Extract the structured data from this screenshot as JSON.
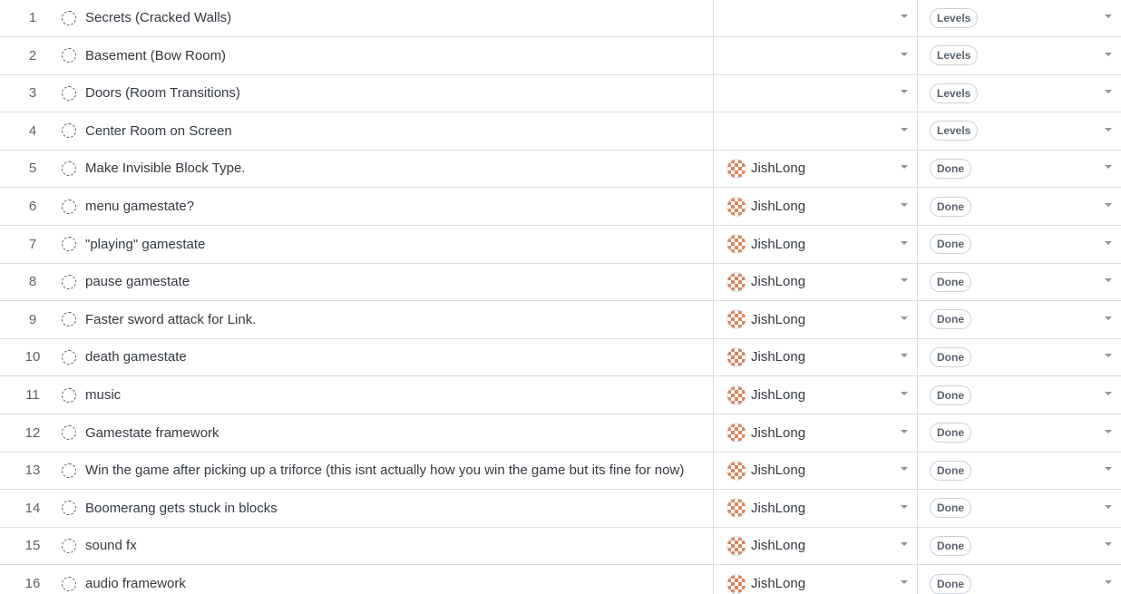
{
  "rows": [
    {
      "num": "1",
      "title": "Secrets (Cracked Walls)",
      "assignee": "",
      "status": "Levels"
    },
    {
      "num": "2",
      "title": "Basement (Bow Room)",
      "assignee": "",
      "status": "Levels"
    },
    {
      "num": "3",
      "title": "Doors (Room Transitions)",
      "assignee": "",
      "status": "Levels"
    },
    {
      "num": "4",
      "title": "Center Room on Screen",
      "assignee": "",
      "status": "Levels"
    },
    {
      "num": "5",
      "title": "Make Invisible Block Type.",
      "assignee": "JishLong",
      "status": "Done"
    },
    {
      "num": "6",
      "title": "menu gamestate?",
      "assignee": "JishLong",
      "status": "Done"
    },
    {
      "num": "7",
      "title": "\"playing\" gamestate",
      "assignee": "JishLong",
      "status": "Done"
    },
    {
      "num": "8",
      "title": "pause gamestate",
      "assignee": "JishLong",
      "status": "Done"
    },
    {
      "num": "9",
      "title": "Faster sword attack for Link.",
      "assignee": "JishLong",
      "status": "Done"
    },
    {
      "num": "10",
      "title": "death gamestate",
      "assignee": "JishLong",
      "status": "Done"
    },
    {
      "num": "11",
      "title": "music",
      "assignee": "JishLong",
      "status": "Done"
    },
    {
      "num": "12",
      "title": "Gamestate framework",
      "assignee": "JishLong",
      "status": "Done"
    },
    {
      "num": "13",
      "title": "Win the game after picking up a triforce (this isnt actually how you win the game but its fine for now)",
      "assignee": "JishLong",
      "status": "Done"
    },
    {
      "num": "14",
      "title": "Boomerang gets stuck in blocks",
      "assignee": "JishLong",
      "status": "Done"
    },
    {
      "num": "15",
      "title": "sound fx",
      "assignee": "JishLong",
      "status": "Done"
    },
    {
      "num": "16",
      "title": "audio framework",
      "assignee": "JishLong",
      "status": "Done"
    }
  ],
  "icons": {
    "status": "dashed-circle-icon",
    "avatar": "identicon-avatar",
    "dropdown": "chevron-down-icon"
  },
  "colors": {
    "border": "#d8dee4",
    "avatar": "#d9875c",
    "badge_text": "#59636e"
  }
}
